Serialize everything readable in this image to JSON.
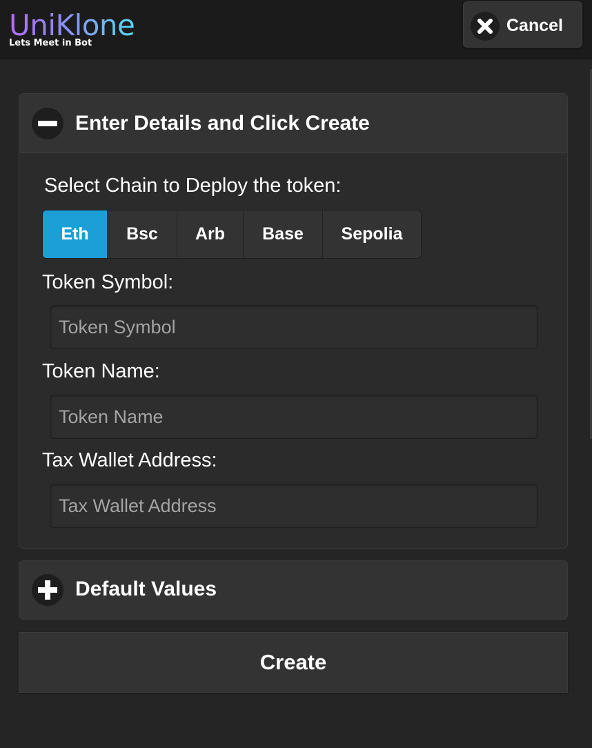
{
  "header": {
    "logo_title": "UniKlone",
    "logo_tagline": "Lets Meet in Bot",
    "cancel_label": "Cancel",
    "cancel_icon": "close-icon"
  },
  "details_panel": {
    "title": "Enter Details and Click Create",
    "toggle_icon": "minus-icon",
    "chain_label": "Select Chain to Deploy the token:",
    "chains": [
      "Eth",
      "Bsc",
      "Arb",
      "Base",
      "Sepolia"
    ],
    "selected_chain": "Eth",
    "symbol_label": "Token Symbol:",
    "symbol_placeholder": "Token Symbol",
    "symbol_value": "",
    "name_label": "Token Name:",
    "name_placeholder": "Token Name",
    "name_value": "",
    "tax_label": "Tax Wallet Address:",
    "tax_placeholder": "Tax Wallet Address",
    "tax_value": ""
  },
  "defaults_panel": {
    "title": "Default Values",
    "toggle_icon": "plus-icon"
  },
  "create_label": "Create",
  "colors": {
    "accent": "#1b9fd6",
    "background": "#252525",
    "header": "#1b1b1b",
    "panel": "#333333",
    "logo_gradient_start": "#b26cf6",
    "logo_gradient_end": "#58d8f0"
  }
}
